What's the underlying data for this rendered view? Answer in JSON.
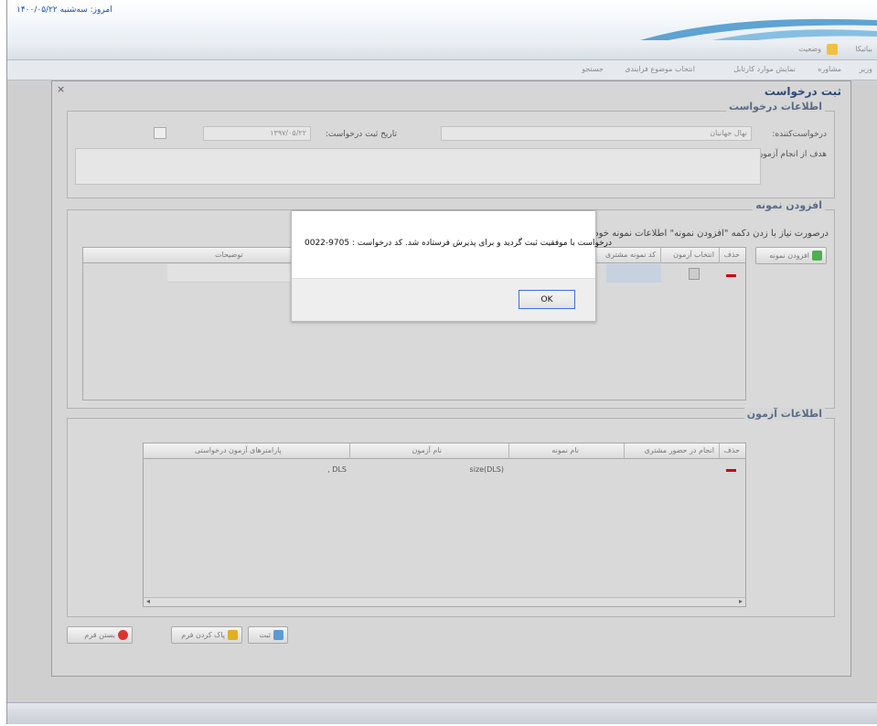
{
  "app": {
    "date_text": "امروز: سه‌شنبه ۱۴۰۰/۰۵/۲۲",
    "nav_links": [
      "بیاتیکا",
      "وضعیت",
      "وزیر",
      "مشاوره",
      "نمایش موارد کارتابل",
      "انتخاب موضوع فرایندی",
      "جستجو"
    ]
  },
  "dialog": {
    "title": "ثبت درخواست",
    "close_icon": "×",
    "request_info": {
      "legend": "اطلاعات درخواست",
      "requester_label": "درخواست‌کننده:",
      "requester_value": "نهال جهانیان",
      "date_label": "تاریخ ثبت درخواست:",
      "date_value": "۱۳۹۷/۰۵/۲۲",
      "purpose_label": "هدف از انجام آزمون:"
    },
    "add_sample": {
      "legend": "افزودن نمونه",
      "hint": "درصورت نیاز با زدن دکمه \"افزودن نمونه\" اطلاعات نمونه خود",
      "add_button": "افزودن نمونه",
      "columns": [
        "حذف",
        "انتخاب آزمون",
        "کد نمونه مشتری",
        "توضیحات"
      ]
    },
    "test_info": {
      "legend": "اطلاعات آزمون",
      "columns": [
        "حذف",
        "انجام در حضور مشتری",
        "نام نمونه",
        "نام آزمون",
        "پارامترهای آزمون درخواستی"
      ],
      "rows": [
        {
          "test_name": "size(DLS)",
          "params": ", DLS"
        }
      ]
    },
    "buttons": {
      "submit": "ثبت",
      "clear": "پاک کردن فرم",
      "close": "بستن فرم"
    }
  },
  "alert": {
    "message": "درخواست با موفقیت ثبت گردید و برای پذیرش فرستاده شد. کد درخواست : 9705-0022",
    "ok_label": "OK"
  },
  "colors": {
    "accent": "#2c4a7a",
    "delete": "#d10000",
    "ok_border": "#3a6fd8"
  }
}
